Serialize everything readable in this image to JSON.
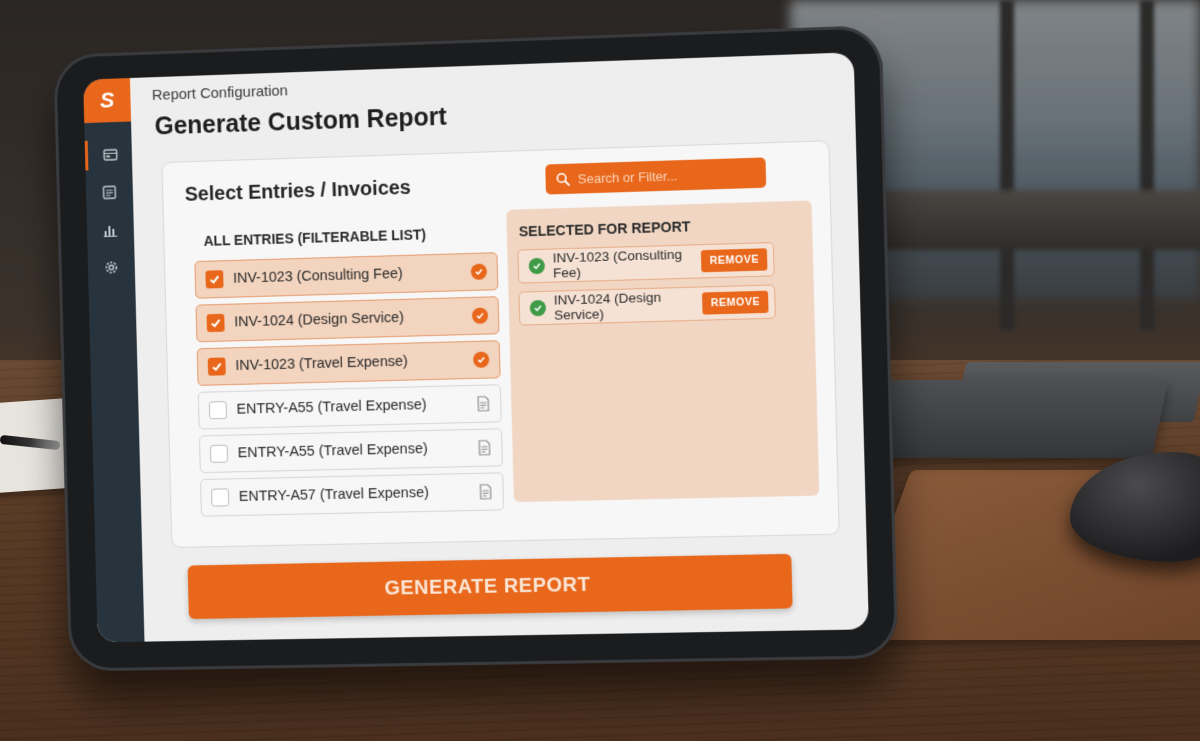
{
  "header": {
    "breadcrumb": "Report Configuration",
    "title": "Generate Custom Report"
  },
  "sidebar": {
    "logo": "S",
    "icons": [
      "dashboard-icon",
      "list-icon",
      "bar-chart-icon",
      "gear-icon"
    ]
  },
  "card": {
    "title": "Select Entries / Invoices",
    "search_placeholder": "Search or Filter..."
  },
  "all_entries": {
    "heading": "ALL ENTRIES (FILTERABLE LIST)",
    "items": [
      {
        "label": "INV-1023 (Consulting Fee)",
        "checked": true
      },
      {
        "label": "INV-1024 (Design Service)",
        "checked": true
      },
      {
        "label": "INV-1023 (Travel Expense)",
        "checked": true
      },
      {
        "label": "ENTRY-A55 (Travel Expense)",
        "checked": false
      },
      {
        "label": "ENTRY-A55 (Travel Expense)",
        "checked": false
      },
      {
        "label": "ENTRY-A57 (Travel Expense)",
        "checked": false
      }
    ]
  },
  "selected": {
    "heading": "SELECTED FOR REPORT",
    "items": [
      {
        "label": "INV-1023 (Consulting Fee)",
        "action": "REMOVE"
      },
      {
        "label": "INV-1024 (Design Service)",
        "action": "REMOVE"
      }
    ]
  },
  "actions": {
    "generate_label": "GENERATE REPORT"
  },
  "colors": {
    "accent": "#e8671b",
    "rail": "#28343d",
    "success": "#3f9b47"
  }
}
